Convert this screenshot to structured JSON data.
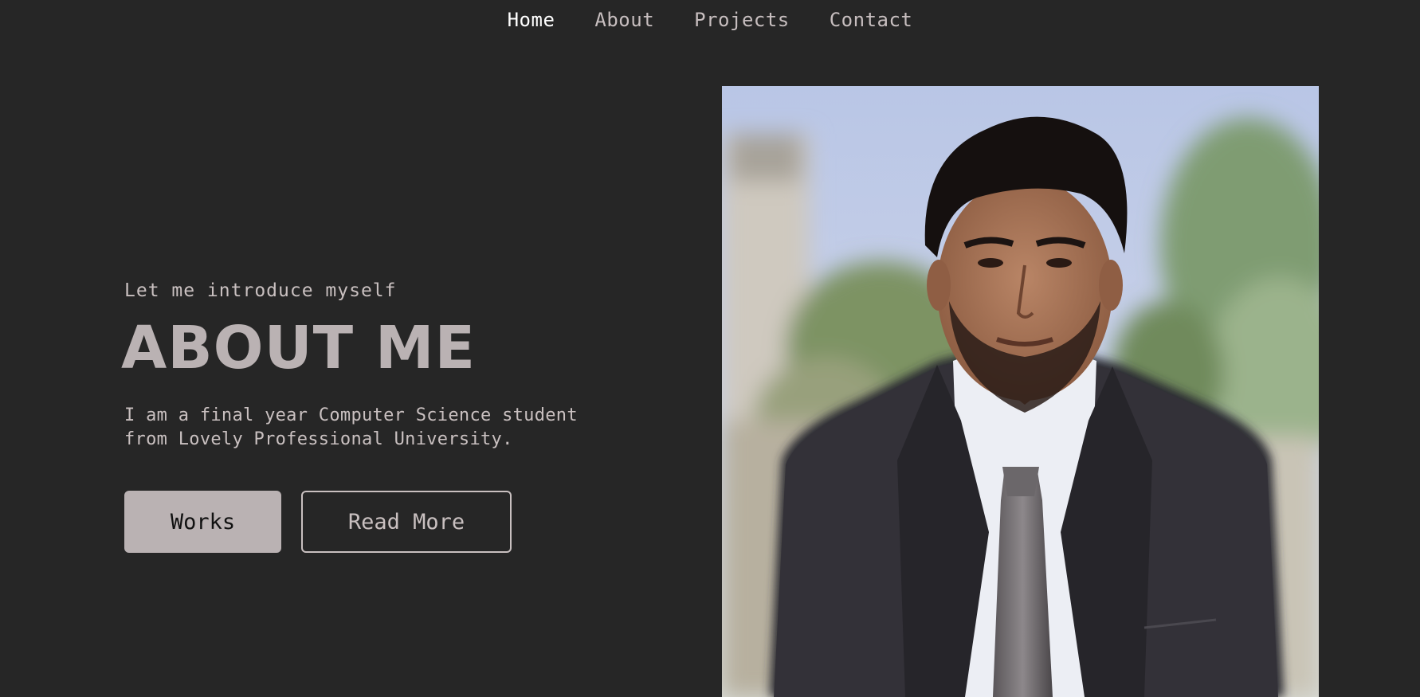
{
  "nav": {
    "items": [
      {
        "label": "Home"
      },
      {
        "label": "About"
      },
      {
        "label": "Projects"
      },
      {
        "label": "Contact"
      }
    ]
  },
  "hero": {
    "intro": "Let me introduce myself",
    "title": "ABOUT ME",
    "description": "I am a final year Computer Science student from Lovely Professional University.",
    "works_button": "Works",
    "read_more_button": "Read More"
  },
  "colors": {
    "background": "#262626",
    "accent": "#bab2b3",
    "nav_active": "#ffffff",
    "text": "#c9c0c0"
  }
}
